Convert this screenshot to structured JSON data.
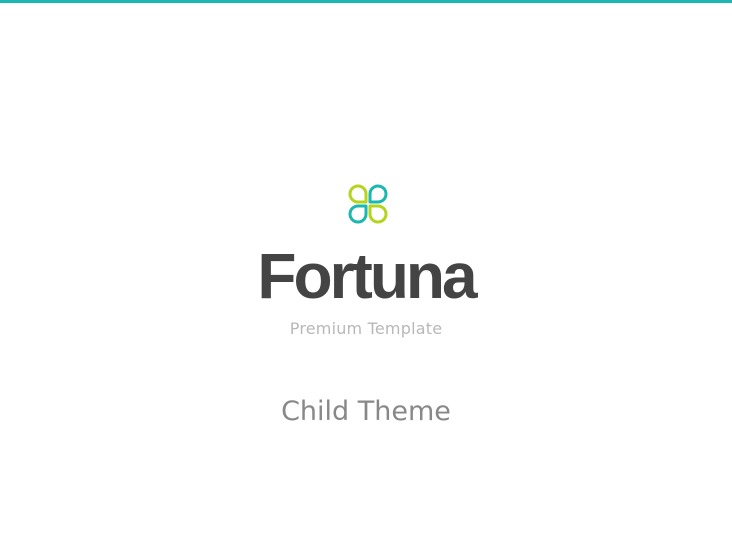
{
  "brand": {
    "name": "Fortuna",
    "tagline": "Premium Template",
    "logo_icon": "four-leaf-clover-icon",
    "colors": {
      "accent": "#1bb7b0",
      "lime": "#b6d41d",
      "teal": "#1bb7b0",
      "wordmark": "#444444",
      "tagline": "#b8b8b8",
      "subtitle": "#888888"
    }
  },
  "theme": {
    "label": "Child Theme"
  }
}
